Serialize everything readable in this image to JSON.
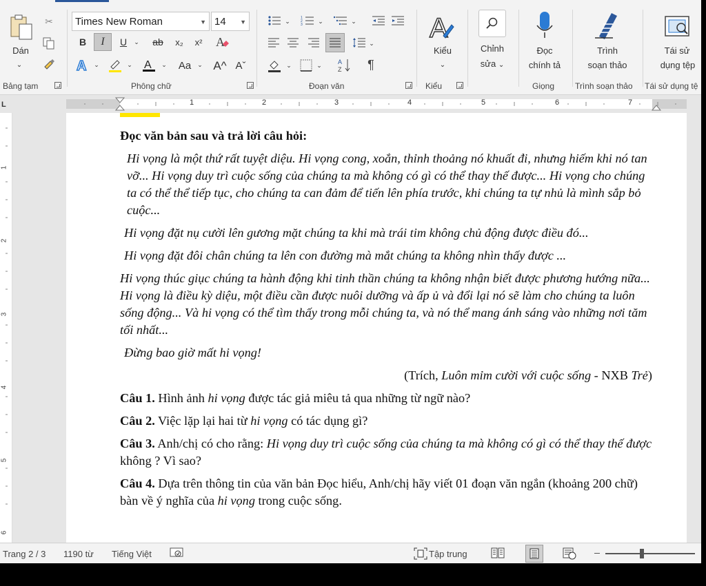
{
  "ribbon": {
    "clipboard": {
      "paste_label": "Dán",
      "group_label": "Bảng tạm"
    },
    "font": {
      "font_name": "Times New Roman",
      "font_size": "14",
      "bold_label": "B",
      "italic_label": "I",
      "underline_label": "U",
      "strike_label": "ab",
      "subscript_label": "x₂",
      "superscript_label": "x²",
      "change_case_label": "Aa",
      "grow_label": "A^",
      "shrink_label": "Aˇ",
      "group_label": "Phông chữ"
    },
    "paragraph": {
      "group_label": "Đoạn văn",
      "sort_label": "A↓Z",
      "pilcrow": "¶"
    },
    "styles": {
      "label": "Kiểu",
      "group_label": "Kiểu"
    },
    "editing": {
      "label_line1": "Chỉnh",
      "label_line2": "sửa"
    },
    "voice": {
      "label_line1": "Đọc",
      "label_line2": "chính tả",
      "group_label": "Giọng"
    },
    "editor": {
      "label_line1": "Trình",
      "label_line2": "soạn thảo",
      "group_label": "Trình soạn thảo"
    },
    "reuse": {
      "label_line1": "Tái sử",
      "label_line2": "dụng tệp",
      "group_label": "Tái sử dụng tệ"
    }
  },
  "ruler": {
    "numbers": [
      "1",
      "2",
      "3",
      "4",
      "5",
      "6",
      "7"
    ]
  },
  "vruler": {
    "numbers": [
      "1",
      "2",
      "3",
      "4",
      "5",
      "6"
    ]
  },
  "document": {
    "heading": "Đọc văn bản sau và trả lời câu hỏi:",
    "para1": "Hi vọng là một thứ rất tuyệt diệu. Hi vọng cong, xoắn, thỉnh thoảng nó khuất đi, nhưng hiếm khi nó tan vỡ... Hi vọng duy trì cuộc sống của chúng ta mà không có gì có thể thay thế được... Hi vọng cho chúng ta có thể thể tiếp tục, cho chúng ta can đảm để tiến lên phía trước, khi chúng ta tự nhủ là mình sắp bỏ cuộc...",
    "para2": "Hi vọng đặt nụ cười lên gương mặt chúng ta khi mà trái tim không chủ động được điều đó...",
    "para3": "Hi vọng đặt đôi chân chúng ta lên con đường mà mắt chúng ta không nhìn thấy được ...",
    "para4": "Hi vọng thúc giục chúng ta hành động khi tinh thần chúng ta không nhận biết được phương hướng nữa... Hi vọng là điều kỳ diệu, một điều cần được nuôi dưỡng và ấp ủ và đổi lại nó sẽ làm cho chúng ta luôn sống động... Và hi vọng có thể tìm thấy trong mỗi chúng ta, và nó thể mang ánh sáng vào những nơi tăm tối nhất...",
    "para5": "Đừng bao giờ mất hi vọng!",
    "source_prefix": "(Trích, ",
    "source_title": "Luôn mỉm cười với cuộc sống",
    "source_mid": " - NXB ",
    "source_pub": "Trẻ",
    "source_suffix": ")",
    "q1_label": "Câu 1.",
    "q1_a": " Hình ảnh ",
    "q1_em": "hi vọng",
    "q1_b": " được tác giả miêu tả qua những từ ngữ nào?",
    "q2_label": "Câu 2.",
    "q2_a": " Việc lặp lại hai từ ",
    "q2_em": "hi vọng",
    "q2_b": " có tác dụng gì?",
    "q3_label": "Câu 3.",
    "q3_a": " Anh/chị có cho rằng: ",
    "q3_em": "Hi vọng duy trì cuộc sống của chúng ta mà không có gì có thể thay thế được",
    "q3_b": " không ? Vì sao?",
    "q4_label": "Câu 4.",
    "q4_a": " Dựa trên thông tin của văn bản Đọc hiểu, Anh/chị hãy viết 01 đoạn văn ngắn (khoảng 200 chữ) bàn về ý nghĩa của ",
    "q4_em": "hi vọng",
    "q4_b": " trong cuộc sống."
  },
  "status": {
    "page": "Trang 2 / 3",
    "words": "1190 từ",
    "language": "Tiếng Việt",
    "focus": "Tập trung"
  }
}
